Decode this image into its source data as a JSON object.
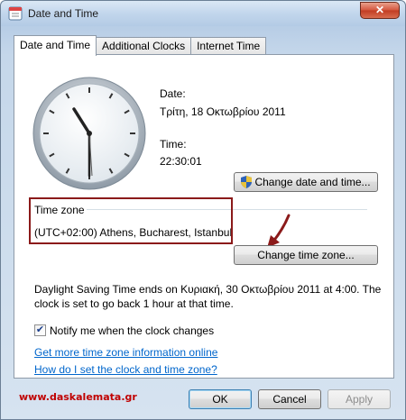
{
  "window": {
    "title": "Date and Time",
    "close_glyph": "✕"
  },
  "tabs": [
    {
      "label": "Date and Time",
      "active": true
    },
    {
      "label": "Additional Clocks",
      "active": false
    },
    {
      "label": "Internet Time",
      "active": false
    }
  ],
  "date": {
    "label": "Date:",
    "value": "Τρίτη, 18 Οκτωβρίου 2011"
  },
  "time": {
    "label": "Time:",
    "value": "22:30:01"
  },
  "buttons": {
    "change_date_time": "Change date and time...",
    "change_time_zone": "Change time zone...",
    "ok": "OK",
    "cancel": "Cancel",
    "apply": "Apply"
  },
  "time_zone": {
    "header": "Time zone",
    "value": "(UTC+02:00) Athens, Bucharest, Istanbul"
  },
  "dst_text": {
    "line1": "Daylight Saving Time ends on Κυριακή, 30 Οκτωβρίου 2011 at 4:00. The",
    "line2": "clock is set to go back 1 hour at that time."
  },
  "notify": {
    "label": "Notify me when the clock changes",
    "checked": true,
    "check_glyph": "✔"
  },
  "links": {
    "more_info": "Get more time zone information online",
    "how_to": "How do I set the clock and time zone?"
  },
  "watermark": "www.daskalemata.gr",
  "colors": {
    "highlight": "#8b1a1a",
    "link": "#0066cc",
    "watermark": "#c00000"
  }
}
